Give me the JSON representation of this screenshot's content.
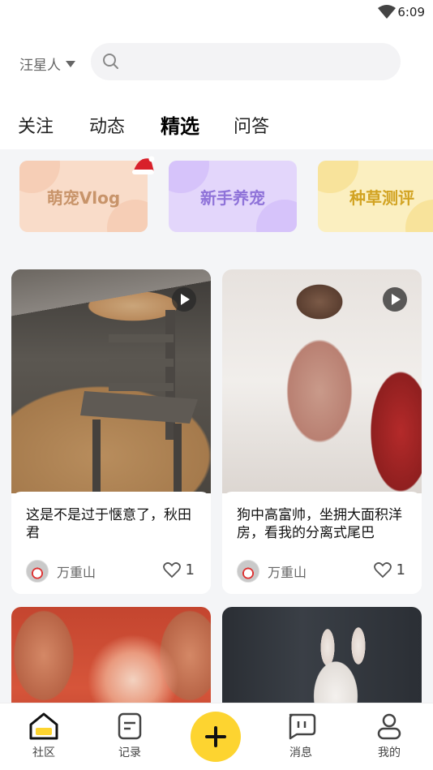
{
  "status_bar": {
    "time": "6:09"
  },
  "header": {
    "pet_selector": "汪星人",
    "search_placeholder": ""
  },
  "tabs": [
    {
      "label": "关注",
      "active": false
    },
    {
      "label": "动态",
      "active": false
    },
    {
      "label": "精选",
      "active": true
    },
    {
      "label": "问答",
      "active": false
    }
  ],
  "categories": [
    {
      "label": "萌宠Vlog",
      "text_color": "#c8946a",
      "bg": "#f9dcc9"
    },
    {
      "label": "新手养宠",
      "text_color": "#8f73d9",
      "bg": "#e3d6fb"
    },
    {
      "label": "种草测评",
      "text_color": "#d2a322",
      "bg": "#fbefc0"
    }
  ],
  "posts": [
    {
      "title": "这是不是过于惬意了，秋田君",
      "author": "万重山",
      "likes": "1",
      "is_video": true
    },
    {
      "title": "狗中高富帅，坐拥大面积洋房，看我的分离式尾巴",
      "author": "万重山",
      "likes": "1",
      "is_video": true
    },
    {
      "title": "",
      "author": "",
      "likes": "",
      "is_video": false
    },
    {
      "title": "",
      "author": "",
      "likes": "",
      "is_video": false
    }
  ],
  "bottom_nav": [
    {
      "label": "社区",
      "icon": "home-icon",
      "active": true
    },
    {
      "label": "记录",
      "icon": "notes-icon",
      "active": false
    },
    {
      "label": "",
      "icon": "plus-icon",
      "active": false
    },
    {
      "label": "消息",
      "icon": "message-icon",
      "active": false
    },
    {
      "label": "我的",
      "icon": "profile-icon",
      "active": false
    }
  ],
  "colors": {
    "accent": "#fdd430",
    "background": "#f4f5f7"
  }
}
